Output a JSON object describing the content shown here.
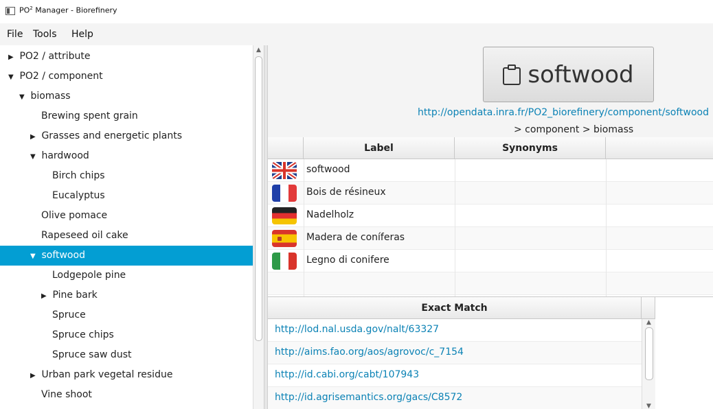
{
  "window": {
    "title_prefix": "PO",
    "title_sup": "2",
    "title_suffix": " Manager  - Biorefinery"
  },
  "menu": [
    "File",
    "Tools",
    "Help"
  ],
  "tree": [
    {
      "label": "PO2 / attribute",
      "arrow": "▶",
      "indent": 0
    },
    {
      "label": "PO2 / component",
      "arrow": "▼",
      "indent": 0
    },
    {
      "label": "biomass",
      "arrow": "▼",
      "indent": 1
    },
    {
      "label": "Brewing spent grain",
      "arrow": "",
      "indent": 2
    },
    {
      "label": "Grasses and energetic plants",
      "arrow": "▶",
      "indent": 2
    },
    {
      "label": "hardwood",
      "arrow": "▼",
      "indent": 2
    },
    {
      "label": "Birch chips",
      "arrow": "",
      "indent": 3
    },
    {
      "label": "Eucalyptus",
      "arrow": "",
      "indent": 3
    },
    {
      "label": "Olive pomace",
      "arrow": "",
      "indent": 2
    },
    {
      "label": "Rapeseed oil cake",
      "arrow": "",
      "indent": 2
    },
    {
      "label": "softwood",
      "arrow": "▼",
      "indent": 2,
      "selected": true
    },
    {
      "label": "Lodgepole pine",
      "arrow": "",
      "indent": 3
    },
    {
      "label": "Pine bark",
      "arrow": "▶",
      "indent": 3
    },
    {
      "label": "Spruce",
      "arrow": "",
      "indent": 3
    },
    {
      "label": "Spruce chips",
      "arrow": "",
      "indent": 3
    },
    {
      "label": "Spruce saw dust",
      "arrow": "",
      "indent": 3
    },
    {
      "label": "Urban park vegetal residue",
      "arrow": "▶",
      "indent": 2
    },
    {
      "label": "Vine shoot",
      "arrow": "",
      "indent": 2
    }
  ],
  "concept": {
    "name": "softwood",
    "uri": "http://opendata.inra.fr/PO2_biorefinery/component/softwood",
    "breadcrumb": "> component > biomass"
  },
  "label_table": {
    "headers": [
      "Label",
      "Synonyms"
    ],
    "rows": [
      {
        "flag": "gb",
        "label": "softwood"
      },
      {
        "flag": "fr",
        "label": "Bois de résineux"
      },
      {
        "flag": "de",
        "label": "Nadelholz"
      },
      {
        "flag": "es",
        "label": "Madera de coníferas"
      },
      {
        "flag": "it",
        "label": "Legno di conifere"
      },
      {
        "flag": "",
        "label": ""
      }
    ]
  },
  "match_table": {
    "header": "Exact Match",
    "rows": [
      "http://lod.nal.usda.gov/nalt/63327",
      "http://aims.fao.org/aos/agrovoc/c_7154",
      "http://id.cabi.org/cabt/107943",
      "http://id.agrisemantics.org/gacs/C8572"
    ]
  },
  "colors": {
    "selection": "#039ed3",
    "link": "#0b82b5"
  }
}
